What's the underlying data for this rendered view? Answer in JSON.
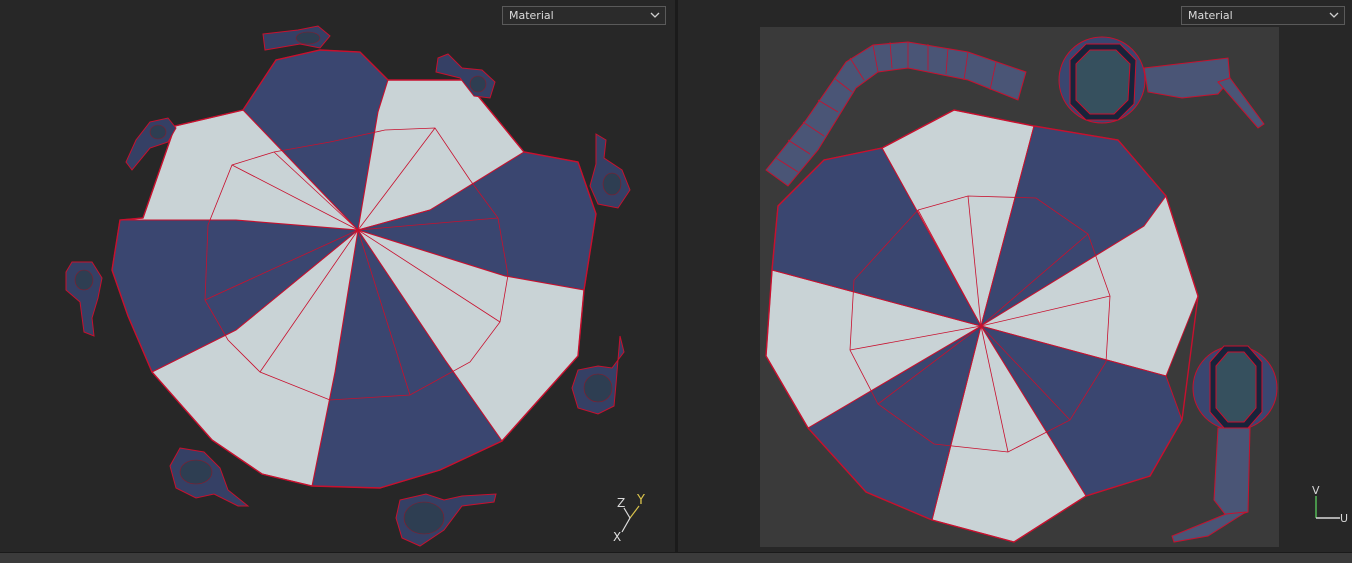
{
  "left_viewport": {
    "shading_dropdown": {
      "value": "Material"
    },
    "axis_gizmo": {
      "labels": [
        "Z",
        "Y",
        "X"
      ]
    }
  },
  "right_viewport": {
    "shading_dropdown": {
      "value": "Material"
    },
    "uv_gizmo": {
      "labels": [
        "V",
        "U"
      ]
    }
  },
  "colors": {
    "viewport_bg": "#272727",
    "uv_tile_bg": "#3a3a3a",
    "fabric_navy": "#3a4670",
    "fabric_white": "#c9d3d6",
    "wireframe_red": "#c8102e",
    "axis_x": "#e0e0e0",
    "axis_y": "#d9c24b",
    "axis_z": "#d9d9d9",
    "uv_axis_v": "#56c25a",
    "uv_axis_u": "#d8d8d8"
  }
}
